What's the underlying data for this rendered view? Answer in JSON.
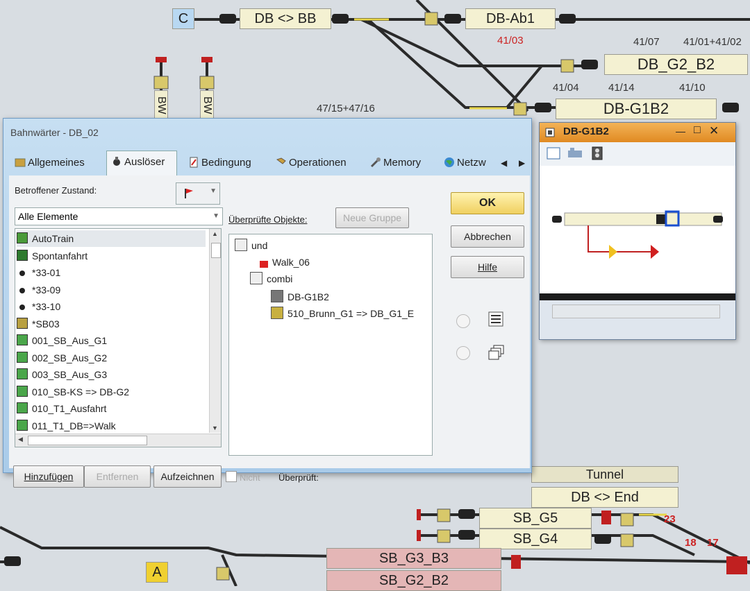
{
  "track": {
    "top_c_badge": "C",
    "blocks": {
      "db_bb": "DB <> BB",
      "db_ab1": "DB-Ab1",
      "db_g2_b2": "DB_G2_B2",
      "db_g1b2": "DB-G1B2",
      "tunnel": "Tunnel",
      "db_end": "DB <> End",
      "sb_g5": "SB_G5",
      "sb_g4": "SB_G4",
      "sb_g3_b3": "SB_G3_B3",
      "sb_g2_b2": "SB_G2_B2",
      "a_badge": "A",
      "bw1": "BW",
      "bw2": "BW"
    },
    "labels": {
      "l4103": "41/03",
      "l4107": "41/07",
      "l4101": "41/01+41/02",
      "l4104": "41/04",
      "l4114": "41/14",
      "l4110": "41/10",
      "l4715": "47/15+47/16",
      "n23": "23",
      "n18": "18",
      "n17": "17"
    }
  },
  "dialog": {
    "title": "Bahnwärter - DB_02",
    "tabs": [
      {
        "label": "Allgemeines"
      },
      {
        "label": "Auslöser"
      },
      {
        "label": "Bedingung"
      },
      {
        "label": "Operationen"
      },
      {
        "label": "Memory"
      },
      {
        "label": "Netzw"
      }
    ],
    "affected_state_label": "Betroffener Zustand:",
    "filter_value": "Alle Elemente",
    "elements": [
      {
        "label": "AutoTrain",
        "icon": "autotrain-icon",
        "color": "#4a9a3a"
      },
      {
        "label": "Spontanfahrt",
        "icon": "spontanfahrt-icon",
        "color": "#2d7a2d"
      },
      {
        "label": "*33-01",
        "icon": "dot-icon",
        "color": "#222222"
      },
      {
        "label": "*33-09",
        "icon": "dot-icon",
        "color": "#222222"
      },
      {
        "label": "*33-10",
        "icon": "dot-icon",
        "color": "#222222"
      },
      {
        "label": "*SB03",
        "icon": "block-icon",
        "color": "#b8a040"
      },
      {
        "label": "001_SB_Aus_G1",
        "icon": "route-icon",
        "color": "#4aa64a"
      },
      {
        "label": "002_SB_Aus_G2",
        "icon": "route-icon",
        "color": "#4aa64a"
      },
      {
        "label": "003_SB_Aus_G3",
        "icon": "route-icon",
        "color": "#4aa64a"
      },
      {
        "label": "010_SB-KS => DB-G2",
        "icon": "route-icon",
        "color": "#4aa64a"
      },
      {
        "label": "010_T1_Ausfahrt",
        "icon": "route-icon",
        "color": "#4aa64a"
      },
      {
        "label": "011_T1_DB=>Walk",
        "icon": "route-icon",
        "color": "#4aa64a"
      }
    ],
    "checked_objects_label": "Überprüfte Objekte:",
    "new_group": "Neue Gruppe",
    "tree": [
      {
        "label": "und",
        "icon": "and-icon"
      },
      {
        "label": "Walk_06",
        "icon": "flag-icon"
      },
      {
        "label": "combi",
        "icon": "combi-icon"
      },
      {
        "label": "DB-G1B2",
        "icon": "signal-icon"
      },
      {
        "label": "510_Brunn_G1 => DB_G1_E",
        "icon": "route-icon"
      }
    ],
    "ok": "OK",
    "cancel": "Abbrechen",
    "help": "Hilfe",
    "add": "Hinzufügen",
    "remove": "Entfernen",
    "record": "Aufzeichnen",
    "not": "Nicht",
    "checked": "Überprüft:"
  },
  "window2": {
    "title": "DB-G1B2"
  },
  "colors": {
    "accent_orange": "#e89a2e",
    "ok_yellow": "#f0d060",
    "dialog_blue": "#b7d4ee"
  }
}
